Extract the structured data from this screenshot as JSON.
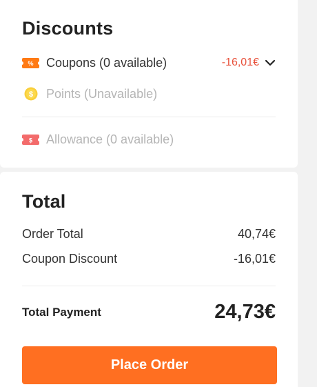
{
  "discounts": {
    "title": "Discounts",
    "coupons": {
      "label": "Coupons (0 available)",
      "value": "-16,01€",
      "icon": "coupon-icon"
    },
    "points": {
      "label": "Points (Unavailable)",
      "icon": "points-coin-icon"
    },
    "allowance": {
      "label": "Allowance (0 available)",
      "icon": "allowance-icon"
    }
  },
  "total": {
    "title": "Total",
    "order_total_label": "Order Total",
    "order_total_value": "40,74€",
    "coupon_discount_label": "Coupon Discount",
    "coupon_discount_value": "-16,01€",
    "total_payment_label": "Total Payment",
    "total_payment_value": "24,73€"
  },
  "actions": {
    "place_order_label": "Place Order"
  },
  "colors": {
    "accent": "#ff6f21",
    "discount_red": "#e8503a",
    "background": "#f2f2f2"
  }
}
